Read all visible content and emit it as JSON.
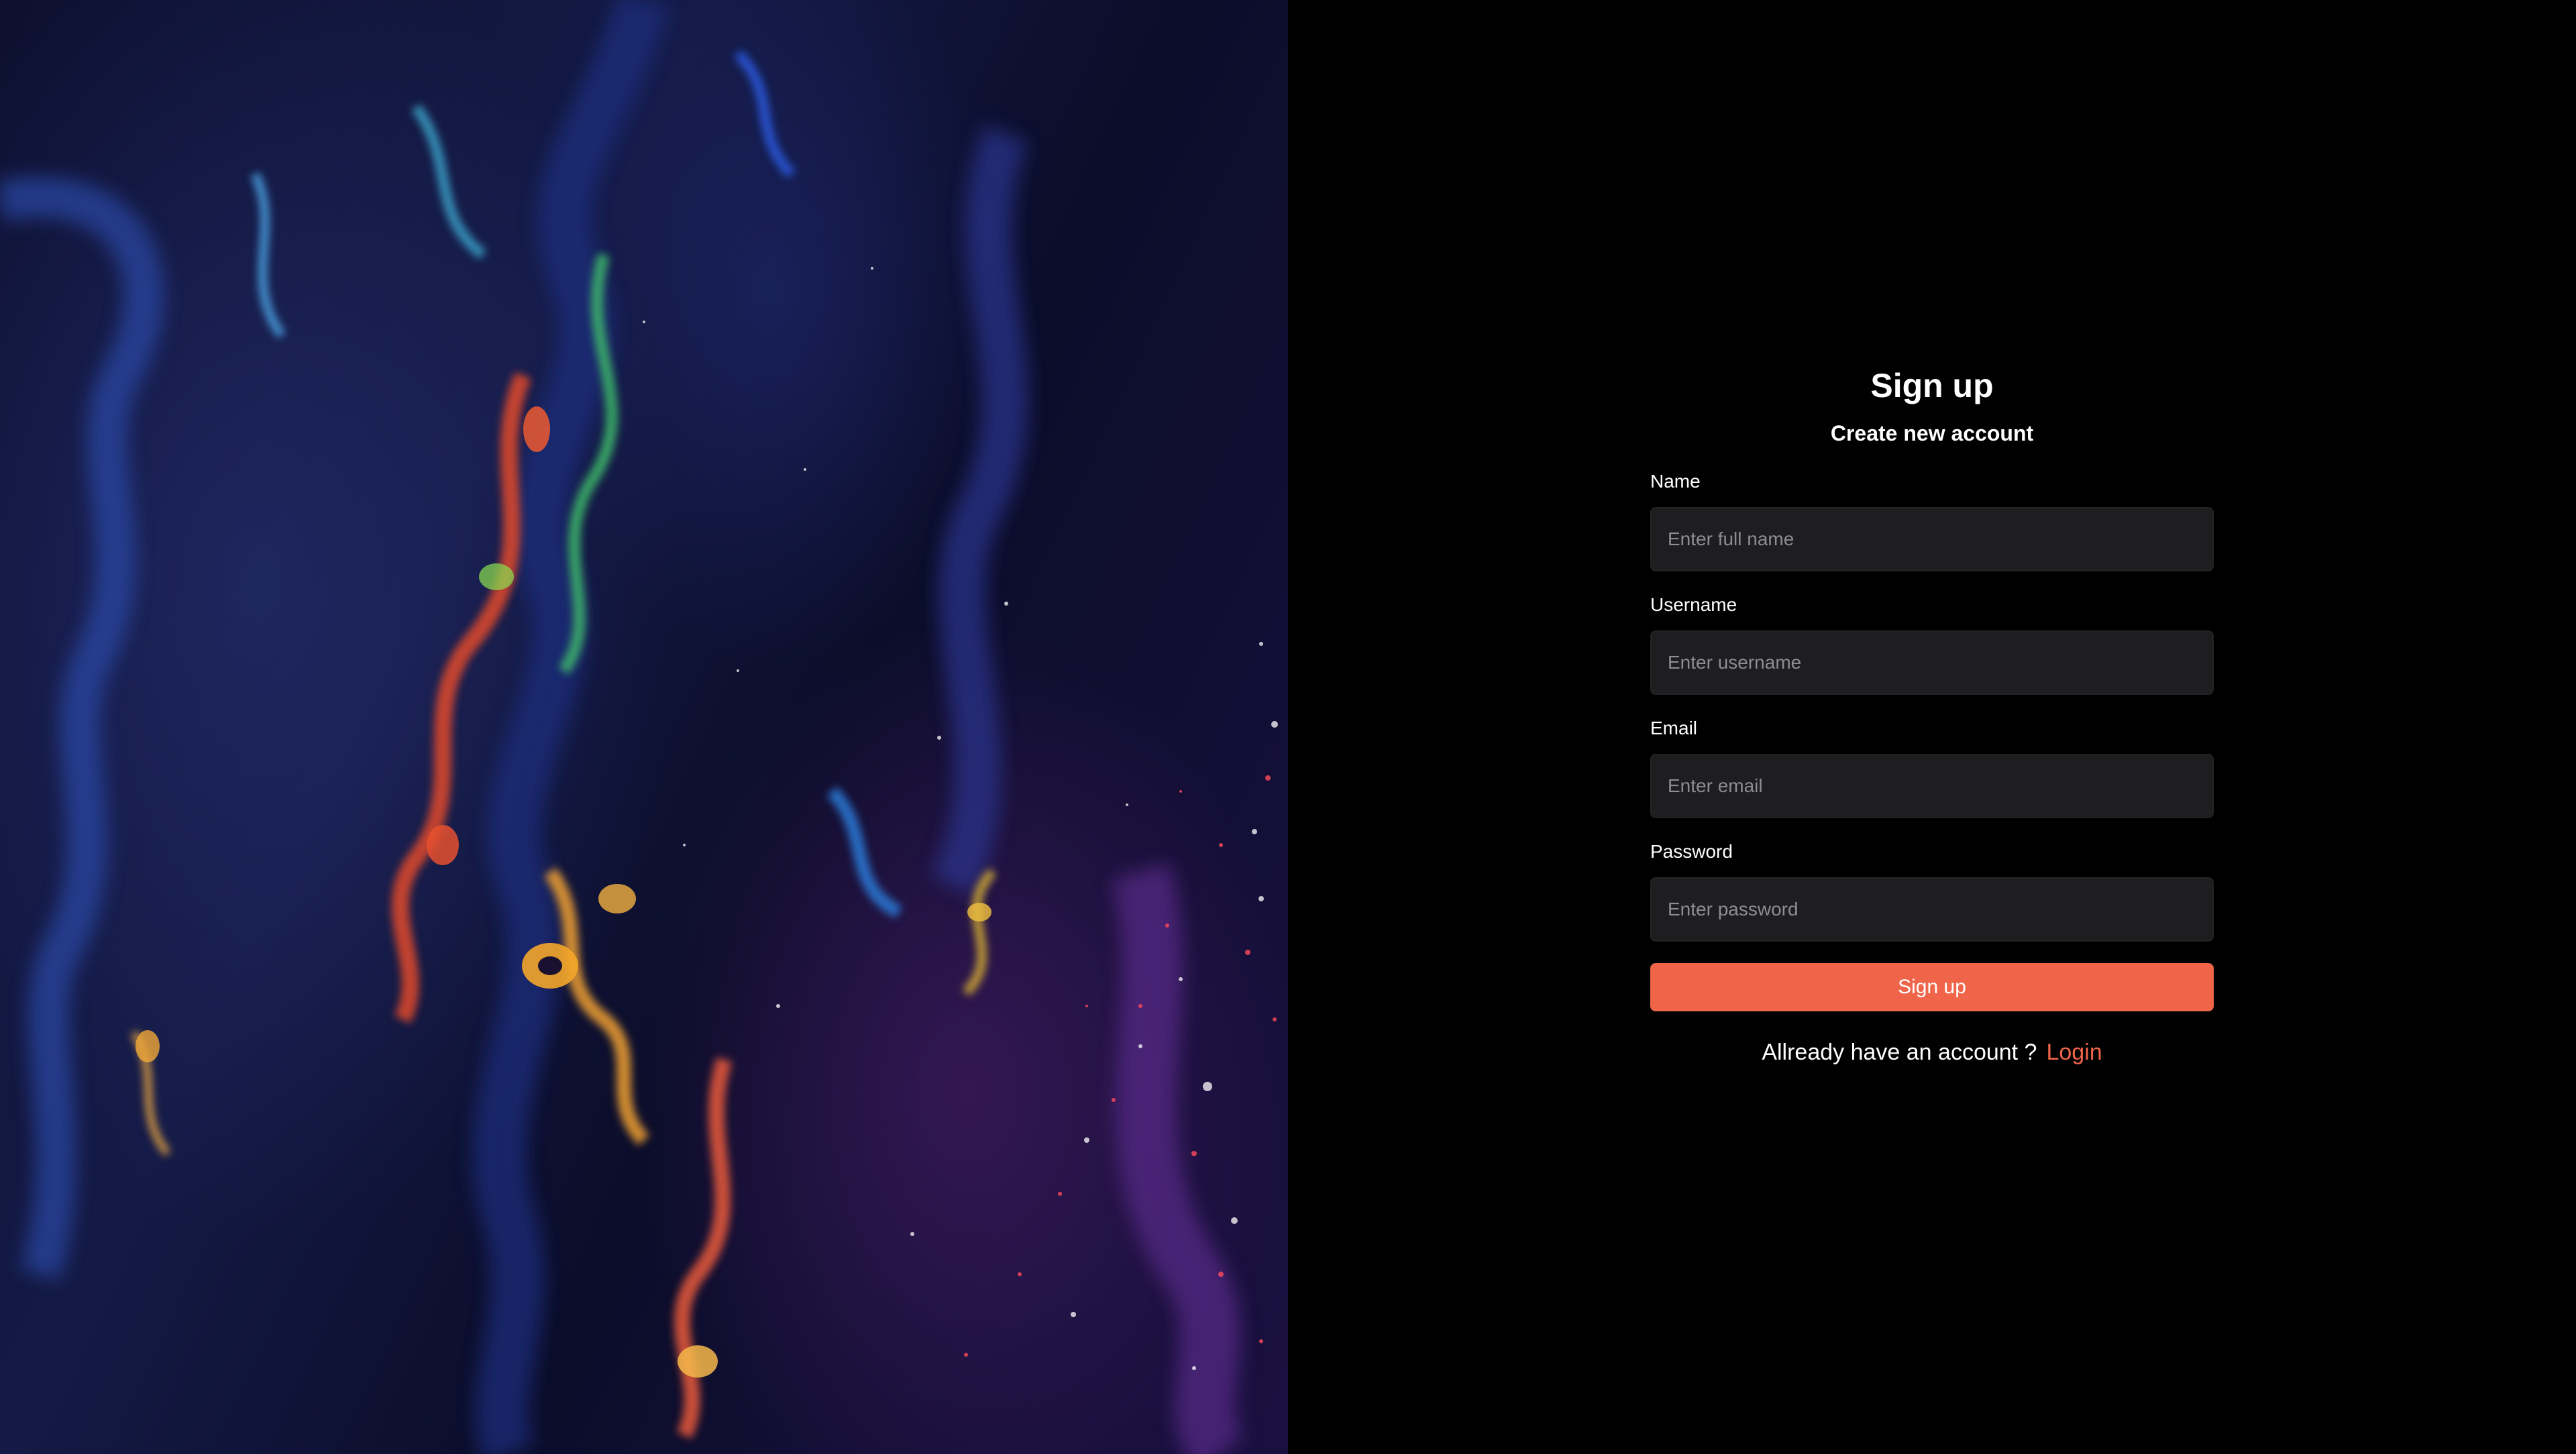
{
  "form": {
    "title": "Sign up",
    "subtitle": "Create new account",
    "fields": [
      {
        "label": "Name",
        "placeholder": "Enter full name",
        "value": ""
      },
      {
        "label": "Username",
        "placeholder": "Enter username",
        "value": ""
      },
      {
        "label": "Email",
        "placeholder": "Enter email",
        "value": ""
      },
      {
        "label": "Password",
        "placeholder": "Enter password",
        "value": ""
      }
    ],
    "submit_label": "Sign up",
    "footer_text": "Allready have an account ?",
    "login_label": "Login"
  },
  "colors": {
    "background": "#000000",
    "input_background": "#1e1e20",
    "accent": "#f0654a",
    "text": "#ffffff",
    "placeholder": "#8d8d92"
  }
}
